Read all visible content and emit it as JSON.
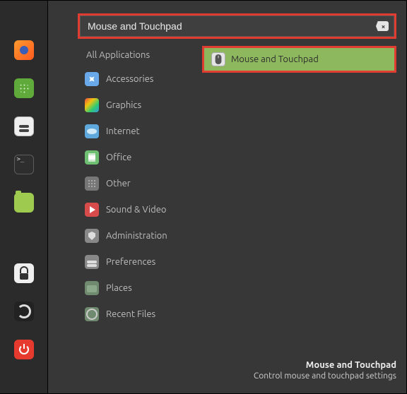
{
  "launcher": {
    "items": [
      {
        "name": "firefox-icon"
      },
      {
        "name": "apps-icon"
      },
      {
        "name": "settings-icon"
      },
      {
        "name": "terminal-icon"
      },
      {
        "name": "files-icon"
      },
      {
        "name": "lock-icon"
      },
      {
        "name": "refresh-icon"
      },
      {
        "name": "power-icon"
      }
    ]
  },
  "search": {
    "value": "Mouse and Touchpad"
  },
  "categories": {
    "all": "All Applications",
    "items": [
      {
        "label": "Accessories"
      },
      {
        "label": "Graphics"
      },
      {
        "label": "Internet"
      },
      {
        "label": "Office"
      },
      {
        "label": "Other"
      },
      {
        "label": "Sound & Video"
      },
      {
        "label": "Administration"
      },
      {
        "label": "Preferences"
      },
      {
        "label": "Places"
      },
      {
        "label": "Recent Files"
      }
    ]
  },
  "results": {
    "items": [
      {
        "label": "Mouse and Touchpad"
      }
    ]
  },
  "tooltip": {
    "title": "Mouse and Touchpad",
    "desc": "Control mouse and touchpad settings"
  },
  "highlight_color": "#e03c31",
  "accent_color": "#8eb85e"
}
